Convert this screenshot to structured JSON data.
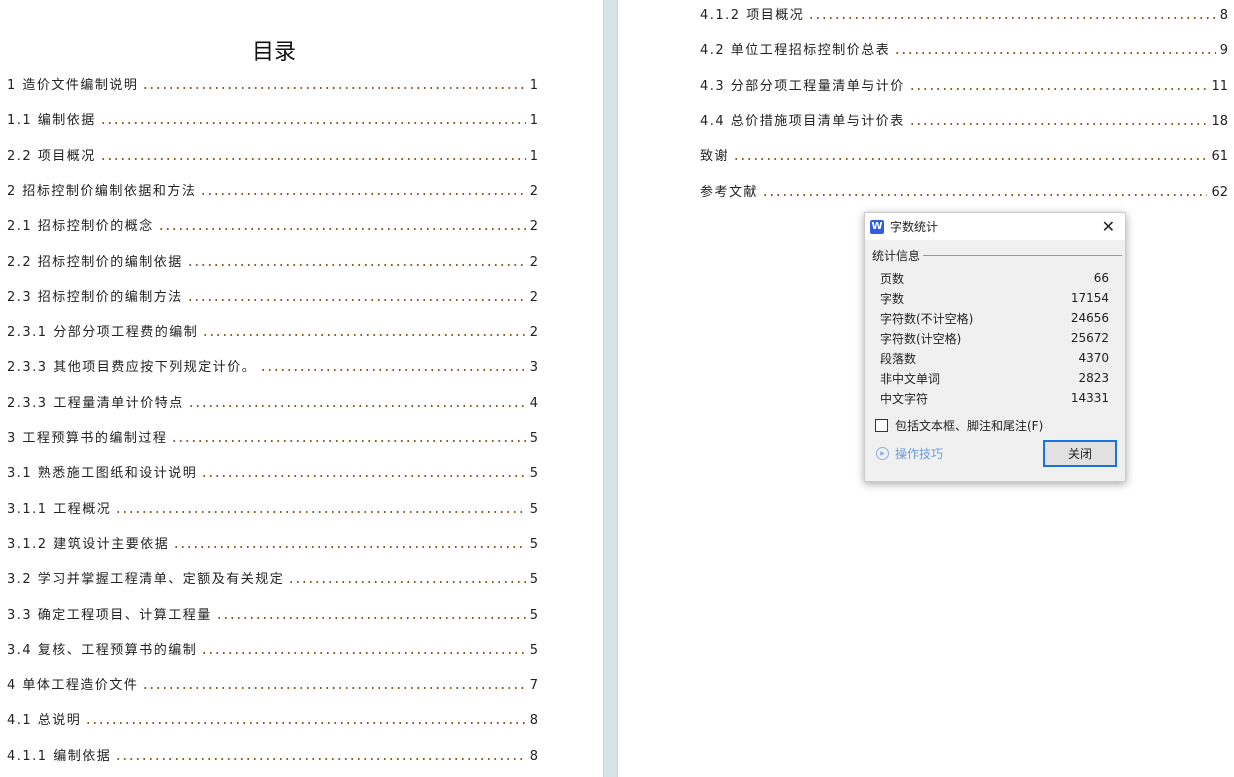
{
  "toc_title": "目录",
  "left_entries": [
    {
      "label": "1 造价文件编制说明",
      "page": "1"
    },
    {
      "label": "1.1 编制依据",
      "page": "1"
    },
    {
      "label": "2.2  项目概况",
      "page": "1"
    },
    {
      "label": "2 招标控制价编制依据和方法",
      "page": "2"
    },
    {
      "label": "2.1 招标控制价的概念",
      "page": "2"
    },
    {
      "label": "2.2 招标控制价的编制依据",
      "page": "2"
    },
    {
      "label": "2.3 招标控制价的编制方法",
      "page": "2"
    },
    {
      "label": "2.3.1 分部分项工程费的编制",
      "page": "2"
    },
    {
      "label": "2.3.3 其他项目费应按下列规定计价。",
      "page": "3"
    },
    {
      "label": "2.3.3 工程量清单计价特点",
      "page": "4"
    },
    {
      "label": "3 工程预算书的编制过程",
      "page": "5"
    },
    {
      "label": "3.1 熟悉施工图纸和设计说明",
      "page": "5"
    },
    {
      "label": "3.1.1 工程概况",
      "page": "5"
    },
    {
      "label": "3.1.2 建筑设计主要依据",
      "page": "5"
    },
    {
      "label": "3.2 学习并掌握工程清单、定额及有关规定",
      "page": "5"
    },
    {
      "label": "3.3 确定工程项目、计算工程量",
      "page": "5"
    },
    {
      "label": "3.4 复核、工程预算书的编制",
      "page": "5"
    },
    {
      "label": "4 单体工程造价文件",
      "page": "7"
    },
    {
      "label": "4.1 总说明",
      "page": "8"
    },
    {
      "label": "4.1.1 编制依据",
      "page": "8"
    }
  ],
  "right_entries": [
    {
      "label": "4.1.2 项目概况",
      "page": "8"
    },
    {
      "label": "4.2 单位工程招标控制价总表",
      "page": "9"
    },
    {
      "label": "4.3 分部分项工程量清单与计价",
      "page": "11"
    },
    {
      "label": "4.4 总价措施项目清单与计价表",
      "page": "18"
    },
    {
      "label": "致谢",
      "page": "61"
    },
    {
      "label": "参考文献",
      "page": "62"
    }
  ],
  "dialog": {
    "title": "字数统计",
    "group": "统计信息",
    "stats": [
      {
        "label": "页数",
        "value": "66"
      },
      {
        "label": "字数",
        "value": "17154"
      },
      {
        "label": "字符数(不计空格)",
        "value": "24656"
      },
      {
        "label": "字符数(计空格)",
        "value": "25672"
      },
      {
        "label": "段落数",
        "value": "4370"
      },
      {
        "label": "非中文单词",
        "value": "2823"
      },
      {
        "label": "中文字符",
        "value": "14331"
      }
    ],
    "checkbox_label": "包括文本框、脚注和尾注(F)",
    "checkbox_checked": false,
    "tips_label": "操作技巧",
    "close_label": "关闭"
  }
}
